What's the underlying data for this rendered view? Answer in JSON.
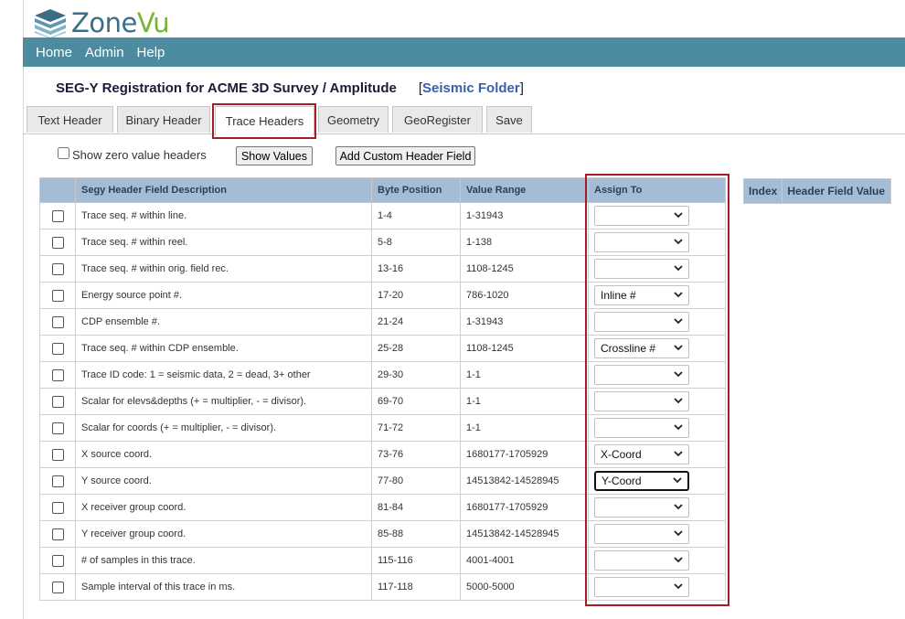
{
  "app": {
    "name_part1": "Zone",
    "name_part2": "Vu"
  },
  "nav": [
    "Home",
    "Admin",
    "Help"
  ],
  "page": {
    "title": "SEG-Y Registration for ACME 3D Survey / Amplitude",
    "folder_open": "[",
    "folder_link": "Seismic Folder",
    "folder_close": "]"
  },
  "tabs": [
    {
      "label": "Text Header"
    },
    {
      "label": "Binary Header"
    },
    {
      "label": "Trace Headers"
    },
    {
      "label": "Geometry"
    },
    {
      "label": "GeoRegister"
    },
    {
      "label": "Save"
    }
  ],
  "active_tab": "Trace Headers",
  "controls": {
    "zero_label": "Show zero value headers",
    "show_values": "Show Values",
    "add_custom": "Add Custom Header Field"
  },
  "table": {
    "headers": [
      "Segy Header Field Description",
      "Byte Position",
      "Value Range",
      "Assign To"
    ],
    "rows": [
      {
        "desc": "Trace seq. # within line.",
        "byte": "1-4",
        "range": "1-31943",
        "assign": ""
      },
      {
        "desc": "Trace seq. # within reel.",
        "byte": "5-8",
        "range": "1-138",
        "assign": ""
      },
      {
        "desc": "Trace seq. # within orig. field rec.",
        "byte": "13-16",
        "range": "1108-1245",
        "assign": ""
      },
      {
        "desc": "Energy source point #.",
        "byte": "17-20",
        "range": "786-1020",
        "assign": "Inline #"
      },
      {
        "desc": "CDP ensemble #.",
        "byte": "21-24",
        "range": "1-31943",
        "assign": ""
      },
      {
        "desc": "Trace seq. # within CDP ensemble.",
        "byte": "25-28",
        "range": "1108-1245",
        "assign": "Crossline #"
      },
      {
        "desc": "Trace ID code: 1 = seismic data, 2 = dead, 3+ other",
        "byte": "29-30",
        "range": "1-1",
        "assign": ""
      },
      {
        "desc": "Scalar for elevs&depths (+ = multiplier, - = divisor).",
        "byte": "69-70",
        "range": "1-1",
        "assign": ""
      },
      {
        "desc": "Scalar for coords (+ = multiplier, - = divisor).",
        "byte": "71-72",
        "range": "1-1",
        "assign": ""
      },
      {
        "desc": "X source coord.",
        "byte": "73-76",
        "range": "1680177-1705929",
        "assign": "X-Coord"
      },
      {
        "desc": "Y source coord.",
        "byte": "77-80",
        "range": "14513842-14528945",
        "assign": "Y-Coord"
      },
      {
        "desc": "X receiver group coord.",
        "byte": "81-84",
        "range": "1680177-1705929",
        "assign": ""
      },
      {
        "desc": "Y receiver group coord.",
        "byte": "85-88",
        "range": "14513842-14528945",
        "assign": ""
      },
      {
        "desc": "# of samples in this trace.",
        "byte": "115-116",
        "range": "4001-4001",
        "assign": ""
      },
      {
        "desc": "Sample interval of this trace in ms.",
        "byte": "117-118",
        "range": "5000-5000",
        "assign": ""
      }
    ]
  },
  "side_table": {
    "headers": [
      "Index",
      "Header Field Value"
    ]
  },
  "colors": {
    "navbar": "#4c8ba0",
    "table_header": "#a4bcd6",
    "highlight": "#a51d24",
    "logo_zone": "#3b6e86",
    "logo_vu": "#78b33a"
  }
}
